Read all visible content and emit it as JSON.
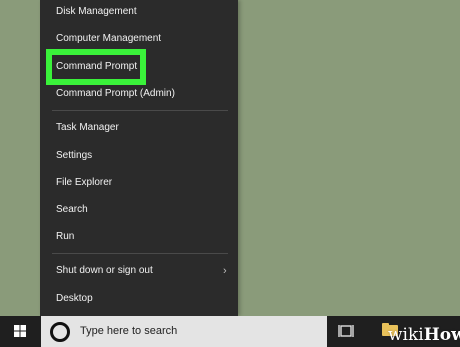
{
  "menu": {
    "items": [
      {
        "label": "Disk Management"
      },
      {
        "label": "Computer Management"
      },
      {
        "label": "Command Prompt"
      },
      {
        "label": "Command Prompt (Admin)"
      },
      {
        "label": "Task Manager"
      },
      {
        "label": "Settings"
      },
      {
        "label": "File Explorer"
      },
      {
        "label": "Search"
      },
      {
        "label": "Run"
      },
      {
        "label": "Shut down or sign out"
      },
      {
        "label": "Desktop"
      }
    ],
    "highlighted_item": "Command Prompt",
    "highlight_color": "#3af23a",
    "background_color": "#2b2b2b"
  },
  "taskbar": {
    "search_placeholder": "Type here to search",
    "icons": [
      "windows-start-icon",
      "cortana-circle-icon",
      "task-view-icon",
      "folder-icon"
    ]
  },
  "watermark": {
    "wiki": "wiki",
    "how": "How"
  },
  "colors": {
    "desktop": "#8a9b7a",
    "taskbar": "#1f1f1f",
    "search_box": "#e4e4e4"
  }
}
